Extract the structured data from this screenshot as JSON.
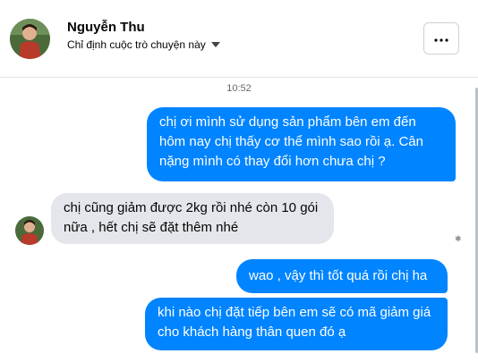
{
  "header": {
    "name": "Nguyễn Thu",
    "subtitle": "Chỉ định cuộc trò chuyện này"
  },
  "timestamp": "10:52",
  "messages": [
    {
      "from": "me",
      "text": "chị ơi mình sử dụng sản phẩm bên em đến hôm nay chị thấy cơ thể mình sao rồi ạ. Cân nặng mình có thay đổi hơn chưa chị ?"
    },
    {
      "from": "contact",
      "text": "chị cũng giảm được 2kg rồi nhé còn 10 gói nữa , hết chị sẽ đặt thêm nhé"
    },
    {
      "from": "me",
      "text": "wao , vậy thì tốt quá rồi chị ha"
    },
    {
      "from": "me",
      "text": "khi nào chị đặt tiếp bên em sẽ có mã giảm giá cho khách hàng thân quen đó ạ"
    }
  ],
  "colors": {
    "outgoing": "#0084ff",
    "incoming": "#e4e6eb"
  },
  "icons": {
    "more": "more-horizontal-icon",
    "dropdown": "caret-down-icon"
  }
}
